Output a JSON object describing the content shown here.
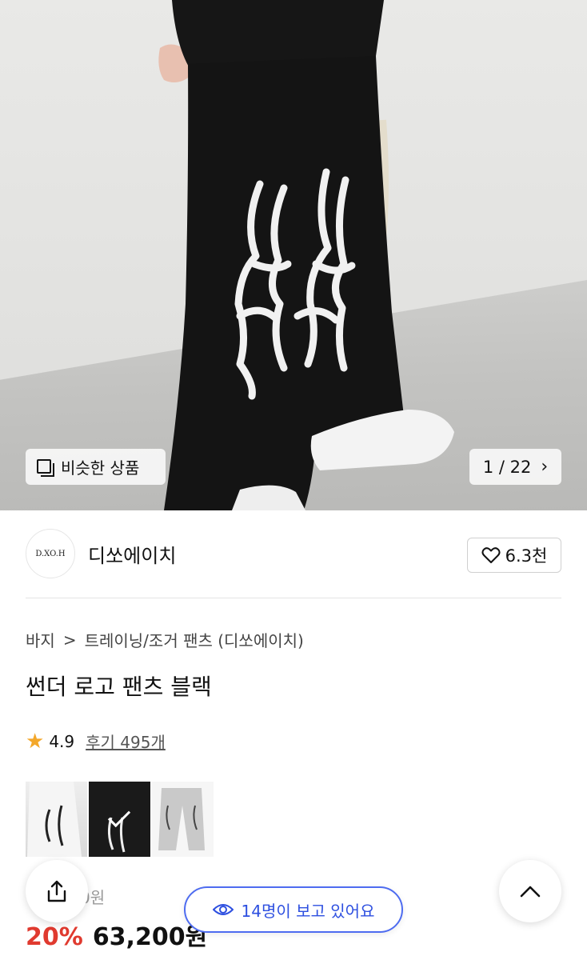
{
  "hero": {
    "similar_label": "비슷한 상품",
    "counter": "1 / 22",
    "chevron": "›"
  },
  "brand": {
    "logo_text": "D.XO.H",
    "name": "디쏘에이치",
    "likes": "6.3천"
  },
  "breadcrumb": {
    "category": "바지",
    "separator": ">",
    "subcategory": "트레이닝/조거 팬츠 (디쏘에이치)"
  },
  "product": {
    "title": "썬더 로고 팬츠 블랙",
    "rating": "4.9",
    "review_label": "후기 495개",
    "original_price": "0원",
    "discount": "20%",
    "price": "63,200원"
  },
  "viewers": {
    "text": "14명이 보고 있어요"
  },
  "colors": {
    "accent_blue": "#2d4fe0",
    "discount_red": "#e03a2f",
    "star": "#f3a72a"
  }
}
